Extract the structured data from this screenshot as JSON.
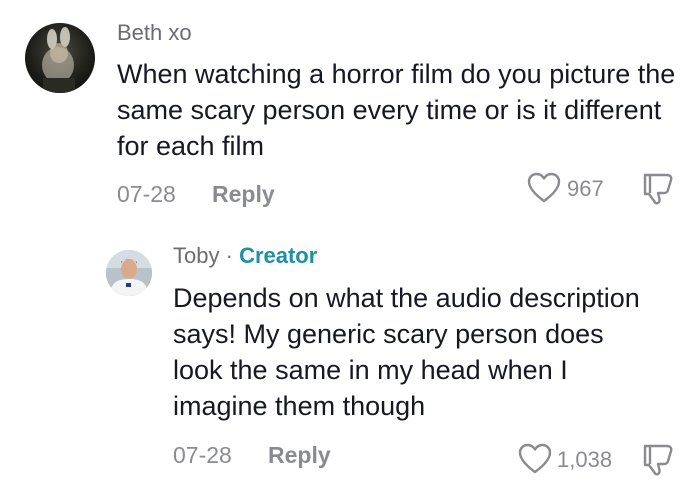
{
  "comments": [
    {
      "username": "Beth xo",
      "text": "When watching a horror film do you picture the same scary person every time or is it different for each film",
      "date": "07-28",
      "reply_label": "Reply",
      "likes": "967"
    },
    {
      "username": "Toby",
      "separator": "·",
      "badge": "Creator",
      "text": "Depends on what the audio description says! My generic scary person does look the same in my head when I imagine them though",
      "date": "07-28",
      "reply_label": "Reply",
      "likes": "1,038"
    }
  ],
  "colors": {
    "text": "#161823",
    "muted": "#8a8b91",
    "creator_badge": "#1f8fa6"
  },
  "icons": [
    "heart-icon",
    "dislike-icon"
  ]
}
